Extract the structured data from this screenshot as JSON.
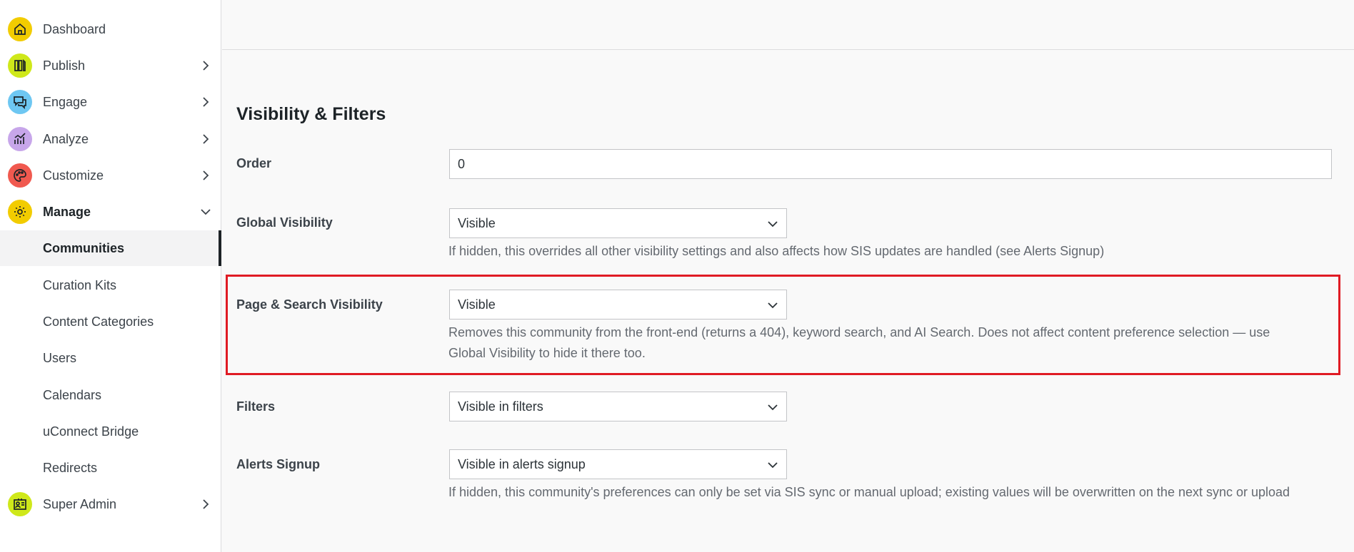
{
  "sidebar": {
    "items": [
      {
        "label": "Dashboard",
        "icon": "home-icon",
        "color": "#f2cc00",
        "has_chevron": false
      },
      {
        "label": "Publish",
        "icon": "publish-icon",
        "color": "#cfe81a",
        "has_chevron": true
      },
      {
        "label": "Engage",
        "icon": "chat-icon",
        "color": "#6ec7f2",
        "has_chevron": true
      },
      {
        "label": "Analyze",
        "icon": "chart-icon",
        "color": "#c7a6ea",
        "has_chevron": true
      },
      {
        "label": "Customize",
        "icon": "palette-icon",
        "color": "#f0594f",
        "has_chevron": true
      },
      {
        "label": "Manage",
        "icon": "gear-icon",
        "color": "#f2cc00",
        "has_chevron": true,
        "expanded": true
      }
    ],
    "manage_sub": [
      {
        "label": "Communities",
        "active": true
      },
      {
        "label": "Curation Kits"
      },
      {
        "label": "Content Categories"
      },
      {
        "label": "Users"
      },
      {
        "label": "Calendars"
      },
      {
        "label": "uConnect Bridge"
      },
      {
        "label": "Redirects"
      }
    ],
    "super_admin": {
      "label": "Super Admin",
      "icon": "id-card-icon",
      "color": "#cfe81a"
    }
  },
  "main": {
    "section_title": "Visibility & Filters",
    "order": {
      "label": "Order",
      "value": "0"
    },
    "global_visibility": {
      "label": "Global Visibility",
      "value": "Visible",
      "help": "If hidden, this overrides all other visibility settings and also affects how SIS updates are handled (see Alerts Signup)"
    },
    "page_search_visibility": {
      "label": "Page & Search Visibility",
      "value": "Visible",
      "help_line1": "Removes this community from the front-end (returns a 404), keyword search, and AI Search. Does not affect content preference selection — use",
      "help_line2": "Global Visibility to hide it there too."
    },
    "filters": {
      "label": "Filters",
      "value": "Visible in filters"
    },
    "alerts_signup": {
      "label": "Alerts Signup",
      "value": "Visible in alerts signup",
      "help": "If hidden, this community's preferences can only be set via SIS sync or manual upload; existing values will be overwritten on the next sync or upload"
    }
  },
  "colors": {
    "highlight": "#e01b24"
  }
}
